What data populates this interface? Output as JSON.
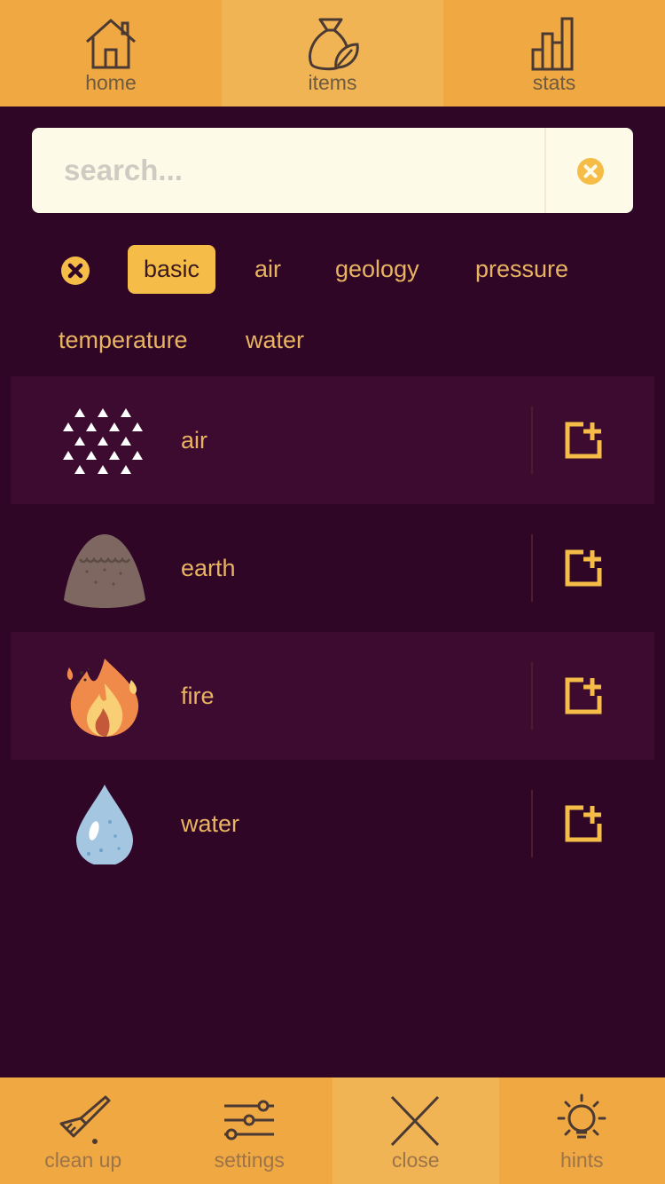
{
  "top_nav": {
    "tabs": [
      {
        "label": "home",
        "icon": "home-icon"
      },
      {
        "label": "items",
        "icon": "items-bag-icon",
        "active": true
      },
      {
        "label": "stats",
        "icon": "stats-icon"
      }
    ]
  },
  "search": {
    "placeholder": "search..."
  },
  "filters": [
    "basic",
    "air",
    "geology",
    "pressure",
    "temperature",
    "water"
  ],
  "active_filter": "basic",
  "items": [
    {
      "name": "air",
      "icon": "air-icon"
    },
    {
      "name": "earth",
      "icon": "earth-icon"
    },
    {
      "name": "fire",
      "icon": "fire-icon"
    },
    {
      "name": "water",
      "icon": "water-drop-icon"
    }
  ],
  "bottom_nav": {
    "tabs": [
      {
        "label": "clean up",
        "icon": "brush-icon"
      },
      {
        "label": "settings",
        "icon": "sliders-icon"
      },
      {
        "label": "close",
        "icon": "close-icon",
        "active": true
      },
      {
        "label": "hints",
        "icon": "lightbulb-icon"
      }
    ]
  },
  "colors": {
    "background": "#300627",
    "row_alt": "#3d0a30",
    "nav": "#f0a843",
    "nav_active": "#f1b455",
    "accent": "#f5bd48",
    "text": "#e9b461"
  }
}
